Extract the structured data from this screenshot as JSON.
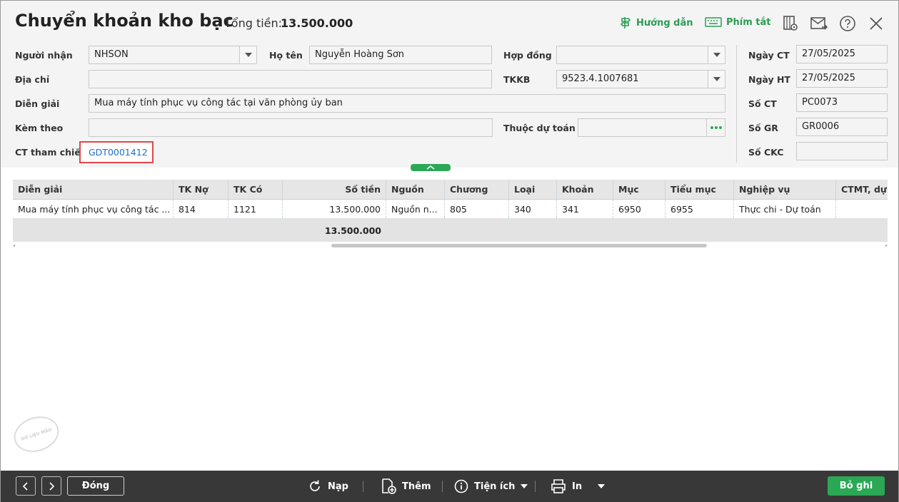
{
  "header": {
    "title": "Chuyển khoản kho bạc",
    "total_label": "Tổng tiền:",
    "total_value": "13.500.000",
    "guide_label": "Hướng dẫn",
    "shortcut_label": "Phím tắt",
    "icons": [
      "preview-icon",
      "mail-icon",
      "help-icon",
      "close-icon"
    ]
  },
  "form": {
    "nguoi_nhan": {
      "label": "Người nhận",
      "value": "NHSON"
    },
    "ho_ten": {
      "label": "Họ tên",
      "value": "Nguyễn Hoàng Sơn"
    },
    "hop_dong": {
      "label": "Hợp đồng",
      "value": ""
    },
    "dia_chi": {
      "label": "Địa chỉ",
      "value": ""
    },
    "tkkb": {
      "label": "TKKB",
      "value": "9523.4.1007681"
    },
    "dien_giai": {
      "label": "Diễn giải",
      "value": "Mua máy tính phục vụ công tác tại văn phòng ủy ban"
    },
    "kem_theo": {
      "label": "Kèm theo",
      "value": ""
    },
    "thuoc_du_toan": {
      "label": "Thuộc dự toán",
      "value": ""
    },
    "ct_tham_chieu": {
      "label": "CT tham chiếu",
      "value": "GDT0001412"
    },
    "ngay_ct": {
      "label": "Ngày CT",
      "value": "27/05/2025"
    },
    "ngay_ht": {
      "label": "Ngày HT",
      "value": "27/05/2025"
    },
    "so_ct": {
      "label": "Số CT",
      "value": "PC0073"
    },
    "so_gr": {
      "label": "Số GR",
      "value": "GR0006"
    },
    "so_ckc": {
      "label": "Số CKC",
      "value": ""
    }
  },
  "grid": {
    "columns": [
      "Diễn giải",
      "TK Nợ",
      "TK Có",
      "Số tiền",
      "Nguồn",
      "Chương",
      "Loại",
      "Khoản",
      "Mục",
      "Tiểu mục",
      "Nghiệp vụ",
      "CTMT, dự á"
    ],
    "rows": [
      [
        "Mua máy tính phục vụ công tác ...",
        "814",
        "1121",
        "13.500.000",
        "Nguồn n...",
        "805",
        "340",
        "341",
        "6950",
        "6955",
        "Thực chi - Dự toán",
        ""
      ]
    ],
    "total": "13.500.000"
  },
  "watermark": "DỮ LIỆU MẪU",
  "footer": {
    "close_label": "Đóng",
    "reload_label": "Nạp",
    "add_label": "Thêm",
    "utility_label": "Tiện ích",
    "print_label": "In",
    "unpost_label": "Bỏ ghi"
  },
  "colors": {
    "accent": "#2aa855",
    "link": "#1e6fc7",
    "highlight": "#e0464b",
    "footer_bg": "#383838"
  }
}
